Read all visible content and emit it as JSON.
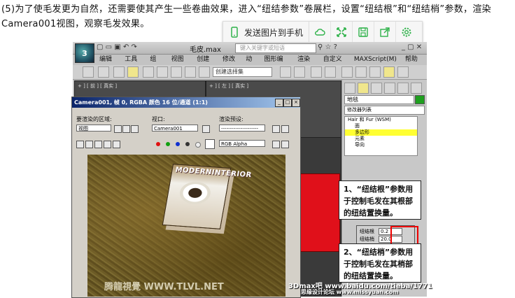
{
  "caption": "(5)为了使毛发更为自然，还需要使其产生一些卷曲效果，进入“纽结参数”卷展栏，设置“纽结根”和“纽结梢”参数，渲染Camera001视图，观察毛发效果。",
  "sharebar": {
    "send_label": "发送图片到手机",
    "icons": [
      "phone-icon",
      "cloud-icon",
      "expand-icon",
      "save-icon",
      "share-icon",
      "settings-icon"
    ],
    "accent": "#2fb24a"
  },
  "app": {
    "logo": "3",
    "window_title": "毛皮.max",
    "search_placeholder": "键入关键字或短语",
    "menu": [
      "编辑(E)",
      "工具(T)",
      "组(G)",
      "视图(V)",
      "创建(C)",
      "修改器",
      "动画",
      "图形编辑器",
      "渲染(R)",
      "自定义(U)",
      "MAXScript(M)",
      "帮助(H)"
    ],
    "selection_set": "创建选择集",
    "viewport_labels": [
      "+ ] [ 前 ] [ 真实 ]",
      "+ ] [ 左 ] [ 真实 ]"
    ]
  },
  "command_panel": {
    "object_name": "地毯",
    "modifier_list": "修改器列表",
    "stack": [
      "Hair 和 Fur (WSM)",
      "面",
      "多边形",
      "元素",
      "导向"
    ],
    "stack_highlight": 2,
    "kink_root_label": "纽结根",
    "kink_root_value": "0.2",
    "kink_tip_label": "纽结梢",
    "kink_tip_value": "20.0"
  },
  "render_frame": {
    "title": "Camera001, 帧 0, RGBA 颜色 16 位/通道 (1:1)",
    "area_label": "要渲染的区域:",
    "area_value": "视图",
    "viewport_label": "视口:",
    "viewport_value": "Camera001",
    "preset_label": "渲染预设:",
    "preset_value": "---------------------",
    "channel_value": "RGB Alpha",
    "book_cover_text": "MODERNINTERIOR"
  },
  "callouts": {
    "c1": "1、“纽结根”参数用于控制毛发在其根部的纽结置换量。",
    "c2": "2、“纽结梢”参数用于控制毛发在其梢部的纽结置换量。"
  },
  "watermarks": {
    "tlvl": "腾龍視覺 WWW.TLVL.NET",
    "site": "3Dmax吧 www.baidu.com/tieba/1771",
    "sub": "思缘设计论坛 www.missyuan.com"
  }
}
